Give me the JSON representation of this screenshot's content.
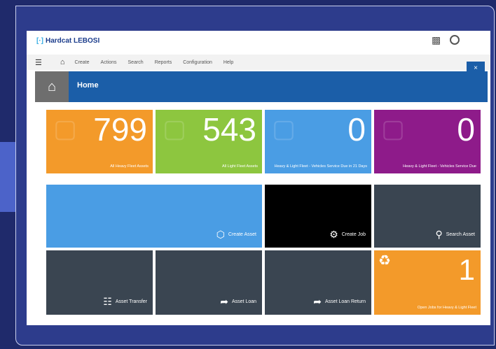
{
  "app": {
    "brand": "Hardcat LEBOSI"
  },
  "menu": {
    "items": [
      "Create",
      "Actions",
      "Search",
      "Reports",
      "Configuration",
      "Help"
    ]
  },
  "header": {
    "title": "Home"
  },
  "close_label": "×",
  "stats": [
    {
      "value": "799",
      "label": "All Heavy Fleet Assets",
      "color": "#f39a2a"
    },
    {
      "value": "543",
      "label": "All Light Fleet Assets",
      "color": "#8dc63f"
    },
    {
      "value": "0",
      "label": "Heavy & Light Fleet - Vehicles Service Due in 21 Days",
      "color": "#4a9de4"
    },
    {
      "value": "0",
      "label": "Heavy & Light Fleet - Vehicles Service Due",
      "color": "#8e1b8a"
    }
  ],
  "actions": {
    "create_asset": "Create Asset",
    "create_job": "Create Job",
    "search_asset": "Search Asset",
    "asset_transfer": "Asset Transfer",
    "asset_loan": "Asset Loan",
    "asset_loan_return": "Asset Loan Return",
    "open_jobs_value": "1",
    "open_jobs_label": "Open Jobs for Heavy & Light Fleet"
  }
}
